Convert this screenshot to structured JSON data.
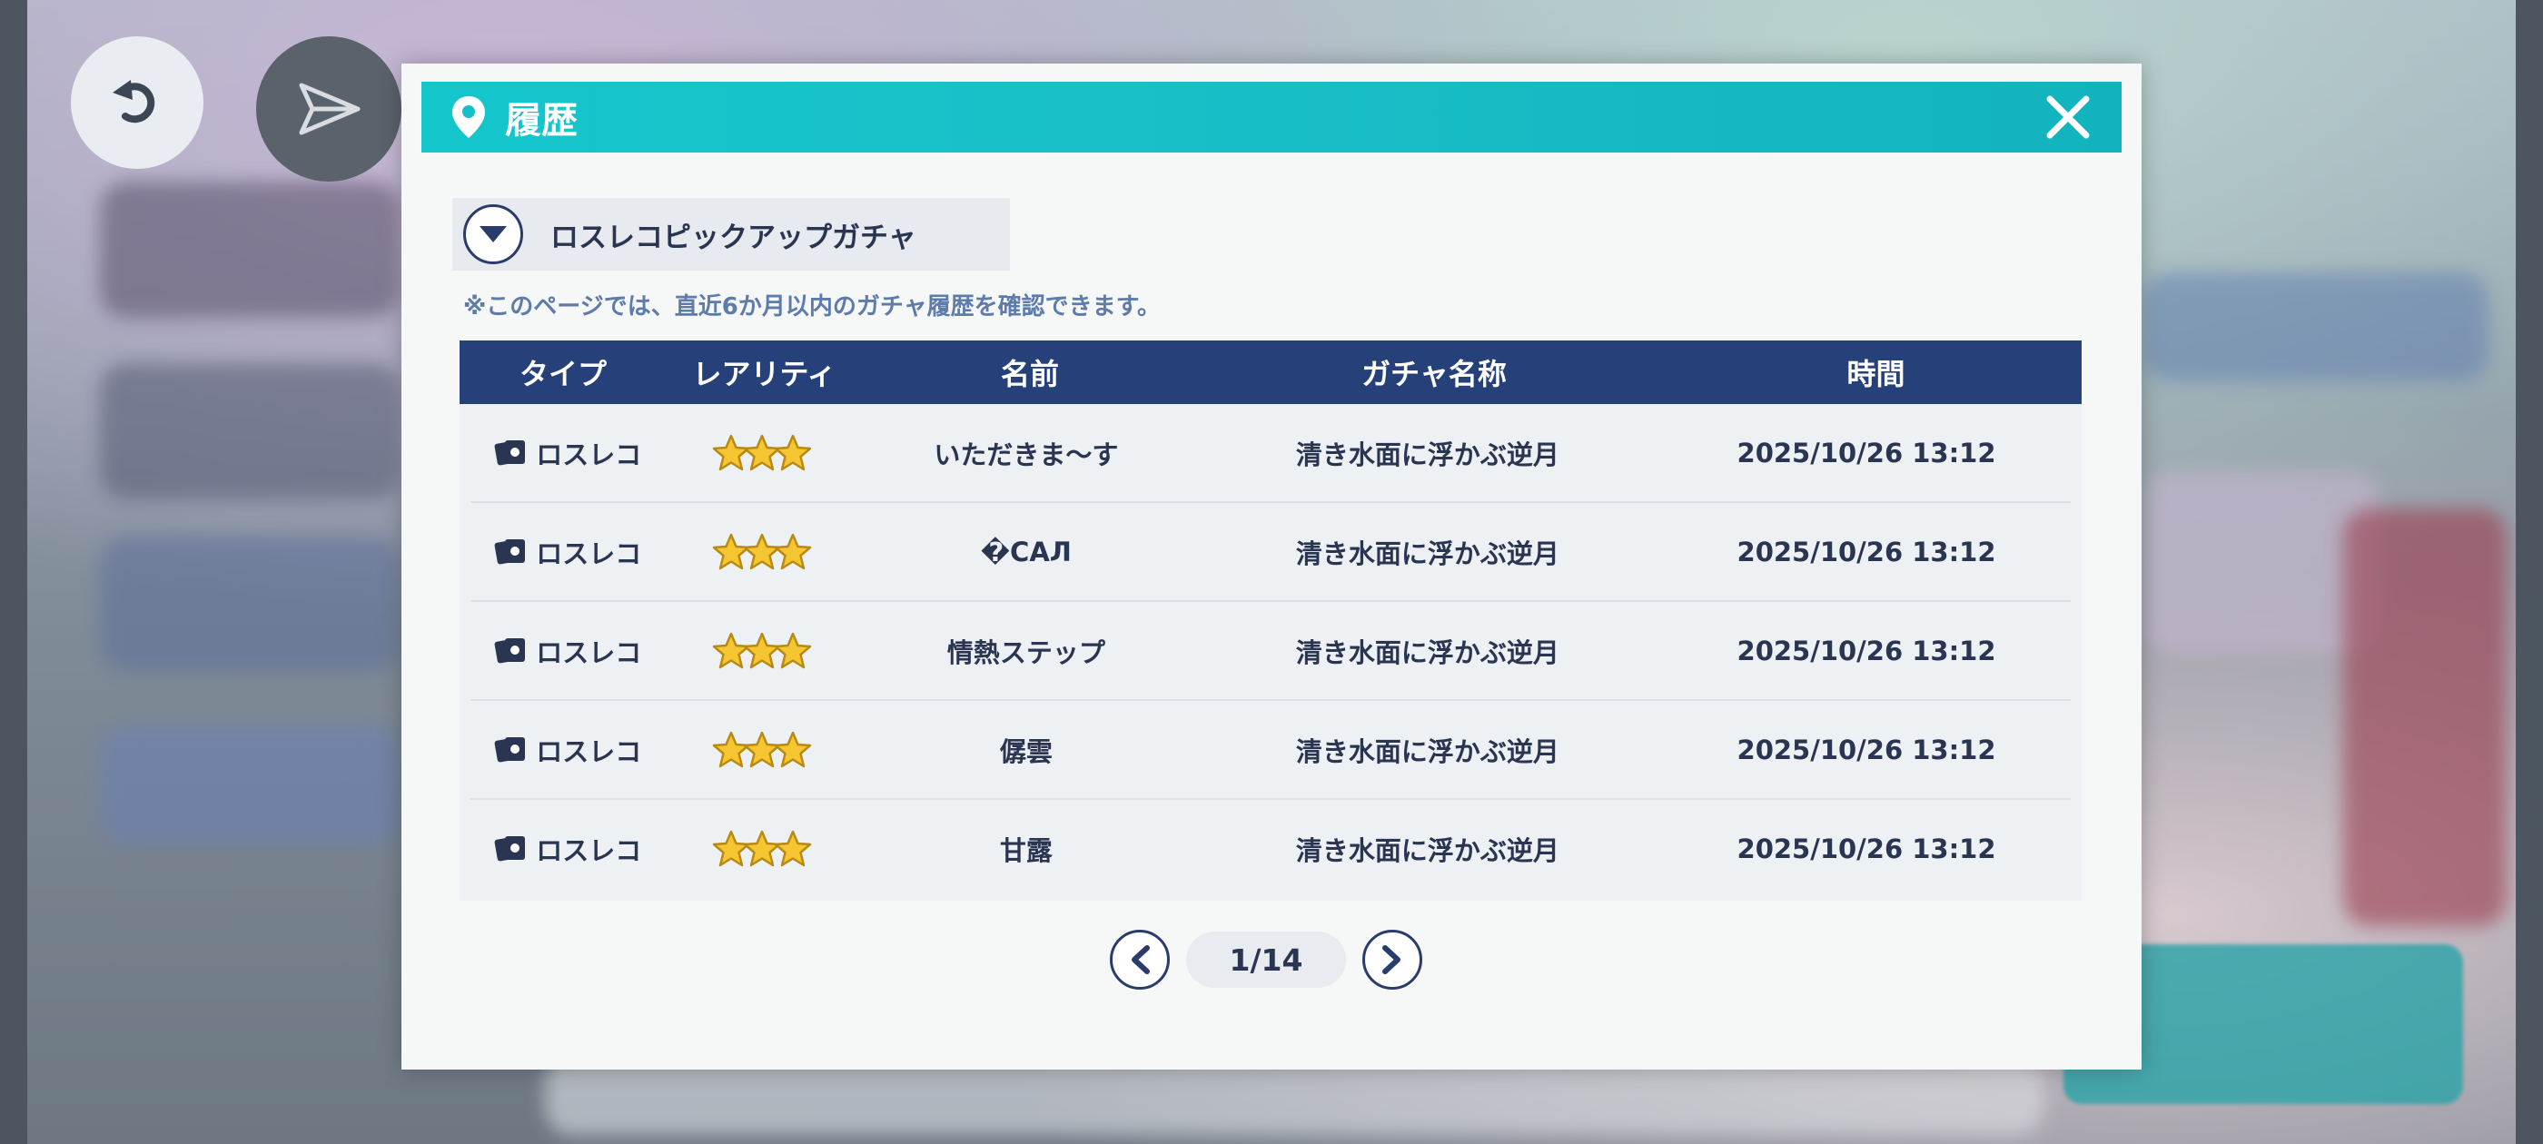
{
  "modal": {
    "title": "履歴",
    "close_icon": "close-icon",
    "pin_icon": "location-pin-icon"
  },
  "filter": {
    "selected": "ロスレコピックアップガチャ",
    "note": "※このページでは、直近6か月以内のガチャ履歴を確認できます。"
  },
  "table": {
    "headers": {
      "type": "タイプ",
      "rarity": "レアリティ",
      "name": "名前",
      "gacha": "ガチャ名称",
      "time": "時間"
    },
    "rows": [
      {
        "type": "ロスレコ",
        "rarity": 3,
        "name": "いただきま～す",
        "gacha": "清き水面に浮かぶ逆月",
        "time": "2025/10/26 13:12"
      },
      {
        "type": "ロスレコ",
        "rarity": 3,
        "name": "�САЛ",
        "gacha": "清き水面に浮かぶ逆月",
        "time": "2025/10/26 13:12"
      },
      {
        "type": "ロスレコ",
        "rarity": 3,
        "name": "情熱ステップ",
        "gacha": "清き水面に浮かぶ逆月",
        "time": "2025/10/26 13:12"
      },
      {
        "type": "ロスレコ",
        "rarity": 3,
        "name": "僝雲",
        "gacha": "清き水面に浮かぶ逆月",
        "time": "2025/10/26 13:12"
      },
      {
        "type": "ロスレコ",
        "rarity": 3,
        "name": "甘露",
        "gacha": "清き水面に浮かぶ逆月",
        "time": "2025/10/26 13:12"
      }
    ]
  },
  "pagination": {
    "label": "1/14"
  },
  "colors": {
    "header_bar": "#14c6cc",
    "table_header": "#26407a",
    "text_primary": "#2a3552",
    "note_text": "#5e7cab"
  }
}
